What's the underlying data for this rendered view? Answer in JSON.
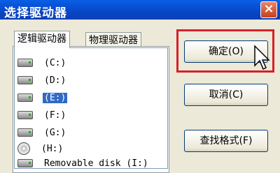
{
  "window": {
    "title": "选择驱动器",
    "close_label": "×"
  },
  "tabs": [
    {
      "label": "逻辑驱动器",
      "active": true
    },
    {
      "label": "物理驱动器",
      "active": false
    }
  ],
  "drives": [
    {
      "label": "(C:)",
      "icon": "hard-disk-icon",
      "selected": false
    },
    {
      "label": "(D:)",
      "icon": "hard-disk-icon",
      "selected": false
    },
    {
      "label": "(E:)",
      "icon": "hard-disk-icon",
      "selected": true
    },
    {
      "label": "(F:)",
      "icon": "hard-disk-icon",
      "selected": false
    },
    {
      "label": "(G:)",
      "icon": "hard-disk-icon",
      "selected": false
    },
    {
      "label": "(H:)",
      "icon": "cd-drive-icon",
      "selected": false
    },
    {
      "label": "Removable disk (I:)",
      "icon": "removable-disk-icon",
      "selected": false
    }
  ],
  "buttons": {
    "ok": "确定(O)",
    "cancel": "取消(C)",
    "find_format": "查找格式(F)"
  },
  "colors": {
    "title_bar": "#0a5fe6",
    "selection": "#316ac5",
    "highlight_box": "#d6202a"
  }
}
